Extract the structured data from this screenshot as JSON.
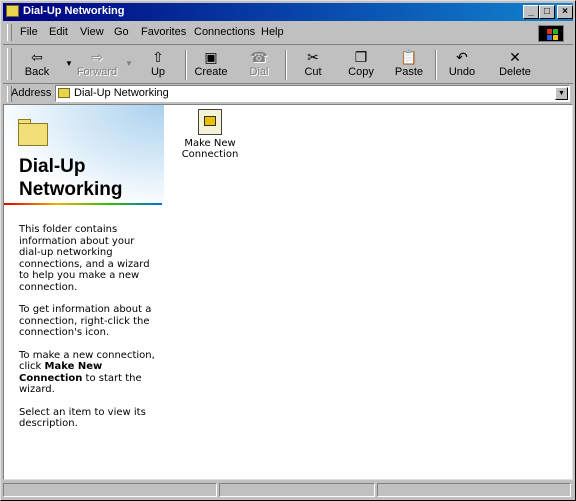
{
  "window": {
    "title": "Dial-Up Networking",
    "controls": {
      "minimize": "_",
      "maximize": "□",
      "close": "×"
    }
  },
  "menu": [
    "File",
    "Edit",
    "View",
    "Go",
    "Favorites",
    "Connections",
    "Help"
  ],
  "toolbar": {
    "back": "Back",
    "forward": "Forward",
    "up": "Up",
    "create": "Create",
    "dial": "Dial",
    "cut": "Cut",
    "copy": "Copy",
    "paste": "Paste",
    "undo": "Undo",
    "delete": "Delete"
  },
  "icons": {
    "back": "back-arrow-icon",
    "forward": "forward-arrow-icon",
    "up": "up-folder-icon",
    "create": "new-connection-icon",
    "dial": "phone-icon",
    "cut": "scissors-icon",
    "copy": "copy-icon",
    "paste": "paste-icon",
    "undo": "undo-icon",
    "delete": "x-delete-icon"
  },
  "address": {
    "label": "Address",
    "value": "Dial-Up Networking"
  },
  "panel": {
    "title": "Dial-Up Networking",
    "paragraphs": {
      "p1": "This folder contains information about your dial-up networking connections, and a wizard to help you make a new connection.",
      "p2": "To get information about a connection, right-click the connection's icon.",
      "p3_before": "To make a new connection, click ",
      "p3_bold": "Make New Connection",
      "p3_after": " to start the wizard.",
      "p4": "Select an item to view its description."
    }
  },
  "items": [
    {
      "label": "Make New Connection"
    }
  ],
  "colors": {
    "titlebar_start": "#000080",
    "titlebar_end": "#1084d0",
    "face": "#c0c0c0"
  }
}
